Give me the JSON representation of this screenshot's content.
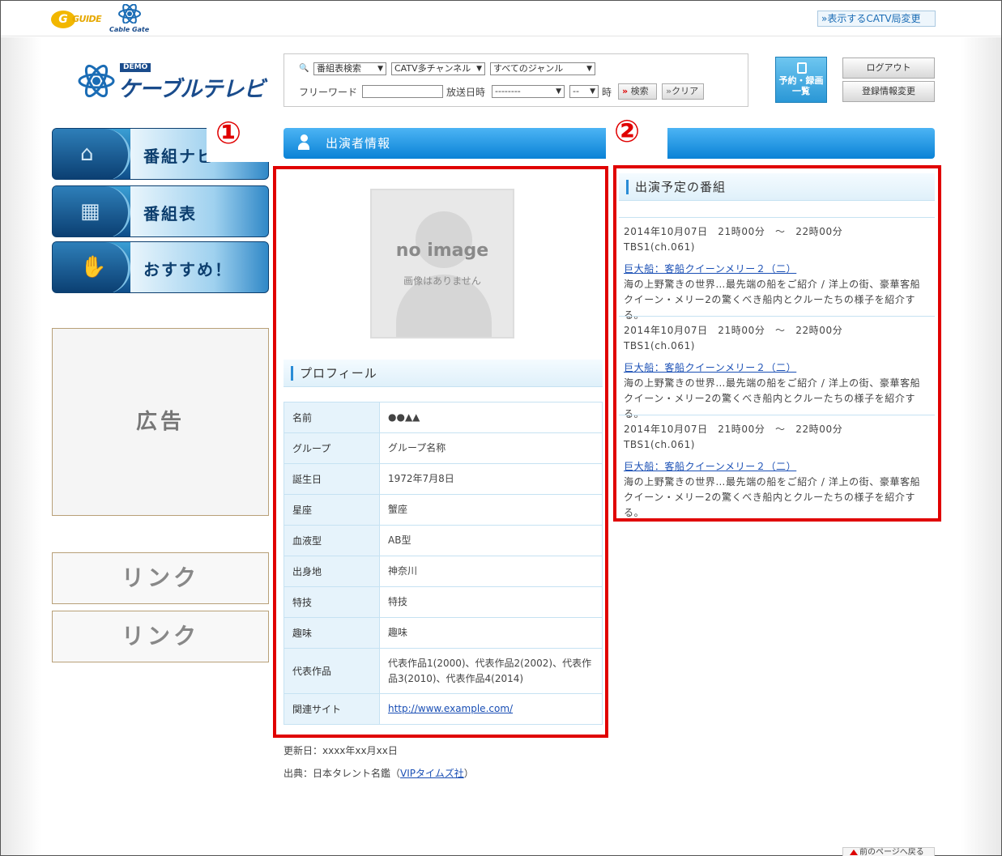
{
  "header": {
    "gguide_mark": "G",
    "gguide_text": "GUIDE",
    "cablegate_text": "Cable Gate",
    "catv_link": "»表示するCATV局変更"
  },
  "logo": {
    "demo": "DEMO",
    "name": "ケーブルテレビ"
  },
  "search": {
    "search_type": "番組表検索",
    "channel": "CATV多チャンネル",
    "genre": "すべてのジャンル",
    "freeword_label": "フリーワード",
    "freeword_value": "",
    "date_label": "放送日時",
    "date_value": "--------",
    "hour_value": "--",
    "hour_label": "時",
    "search_button": "検索",
    "clear_button": "クリア"
  },
  "account": {
    "reserve_label_1": "予約・録画",
    "reserve_label_2": "一覧",
    "logout": "ログアウト",
    "edit_registration": "登録情報変更"
  },
  "nav": [
    {
      "label": "番組ナビ",
      "icon": "home-icon",
      "glyph": "⌂"
    },
    {
      "label": "番組表",
      "icon": "film-icon",
      "glyph": "▦"
    },
    {
      "label": "おすすめ！",
      "icon": "thumbs-up-icon",
      "glyph": "✋"
    }
  ],
  "sidebar": {
    "ad": "広告",
    "link1": "リンク",
    "link2": "リンク"
  },
  "annotations": {
    "one": "①",
    "two": "②"
  },
  "section": {
    "title": "出演者情報"
  },
  "profile": {
    "noimage_title": "no image",
    "noimage_sub": "画像はありません",
    "heading": "プロフィール",
    "rows": [
      {
        "key": "名前",
        "value": "●●▲▲"
      },
      {
        "key": "グループ",
        "value": "グループ名称"
      },
      {
        "key": "誕生日",
        "value": "1972年7月8日"
      },
      {
        "key": "星座",
        "value": "蟹座"
      },
      {
        "key": "血液型",
        "value": "AB型"
      },
      {
        "key": "出身地",
        "value": "神奈川"
      },
      {
        "key": "特技",
        "value": "特技"
      },
      {
        "key": "趣味",
        "value": "趣味"
      },
      {
        "key": "代表作品",
        "value": "代表作品1(2000)、代表作品2(2002)、代表作品3(2010)、代表作品4(2014)"
      },
      {
        "key": "関連サイト",
        "value": "http://www.example.com/"
      }
    ],
    "updated": "更新日：xxxx年xx月xx日",
    "source_prefix": "出典：日本タレント名鑑（",
    "source_link": "VIPタイムズ社",
    "source_suffix": "）"
  },
  "schedule": {
    "heading": "出演予定の番組",
    "items": [
      {
        "datetime": "2014年10月07日　21時00分　～　22時00分",
        "channel": "TBS1(ch.061)",
        "title": "巨大船：客船クイーンメリー２（二）",
        "desc": "海の上野驚きの世界…最先端の船をご紹介 / 洋上の街、豪華客船クイーン・メリー2の驚くべき船内とクルーたちの様子を紹介する。"
      },
      {
        "datetime": "2014年10月07日　21時00分　～　22時00分",
        "channel": "TBS1(ch.061)",
        "title": "巨大船：客船クイーンメリー２（二）",
        "desc": "海の上野驚きの世界…最先端の船をご紹介 / 洋上の街、豪華客船クイーン・メリー2の驚くべき船内とクルーたちの様子を紹介する。"
      },
      {
        "datetime": "2014年10月07日　21時00分　～　22時00分",
        "channel": "TBS1(ch.061)",
        "title": "巨大船：客船クイーンメリー２（二）",
        "desc": "海の上野驚きの世界…最先端の船をご紹介 / 洋上の街、豪華客船クイーン・メリー2の驚くべき船内とクルーたちの様子を紹介する。"
      }
    ]
  },
  "footer": {
    "page_top": "前のページへ戻る"
  },
  "colors": {
    "accent": "#0a82d6",
    "annotation_red": "#e00000",
    "link": "#1a4fb5"
  }
}
